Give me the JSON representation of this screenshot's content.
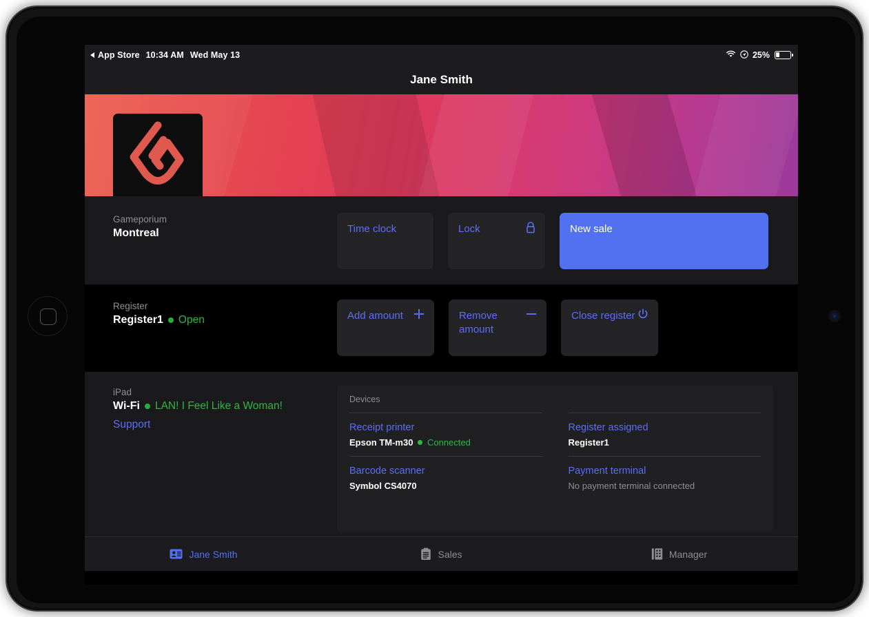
{
  "statusbar": {
    "back_app": "App Store",
    "time": "10:34 AM",
    "date": "Wed May 13",
    "wifi_icon": "wifi-icon",
    "location_icon": "location-arrow-icon",
    "battery_percent": "25%",
    "battery_icon": "battery-icon"
  },
  "navbar": {
    "title": "Jane Smith"
  },
  "hero": {
    "logo_icon": "lightspeed-flame-logo",
    "gradient_start": "#ec5f4e",
    "gradient_end": "#9c3a9c"
  },
  "store": {
    "label": "Gameporium",
    "value": "Montreal",
    "actions": [
      {
        "label": "Time clock",
        "icon": null,
        "style": "secondary"
      },
      {
        "label": "Lock",
        "icon": "lock-icon",
        "style": "secondary"
      },
      {
        "label": "New sale",
        "icon": null,
        "style": "primary"
      }
    ]
  },
  "register": {
    "label": "Register",
    "name": "Register1",
    "status": "Open",
    "status_color": "#2fb544",
    "actions": [
      {
        "label": "Add amount",
        "icon": "plus-icon"
      },
      {
        "label": "Remove amount",
        "icon": "minus-icon"
      },
      {
        "label": "Close register",
        "icon": "power-icon"
      }
    ]
  },
  "device_info": {
    "label": "iPad",
    "network_type": "Wi-Fi",
    "network_name": "LAN! I Feel Like a Woman!",
    "network_color": "#2fb544",
    "support_link": "Support"
  },
  "devices": {
    "header": "Devices",
    "left": [
      {
        "title": "Receipt printer",
        "sub": "Epson TM-m30",
        "status": "Connected",
        "has_dot": true
      },
      {
        "title": "Barcode scanner",
        "sub": "Symbol CS4070",
        "status": "",
        "has_dot": false
      }
    ],
    "right": [
      {
        "title": "Register assigned",
        "sub": "Register1",
        "status": "",
        "has_dot": false
      },
      {
        "title": "Payment terminal",
        "sub": "",
        "status": "",
        "muted": "No payment terminal connected",
        "has_dot": false
      }
    ]
  },
  "tabbar": {
    "tabs": [
      {
        "label": "Jane Smith",
        "icon": "id-card-icon",
        "active": true
      },
      {
        "label": "Sales",
        "icon": "clipboard-icon",
        "active": false
      },
      {
        "label": "Manager",
        "icon": "register-building-icon",
        "active": false
      }
    ],
    "active_color": "#5271f0"
  }
}
